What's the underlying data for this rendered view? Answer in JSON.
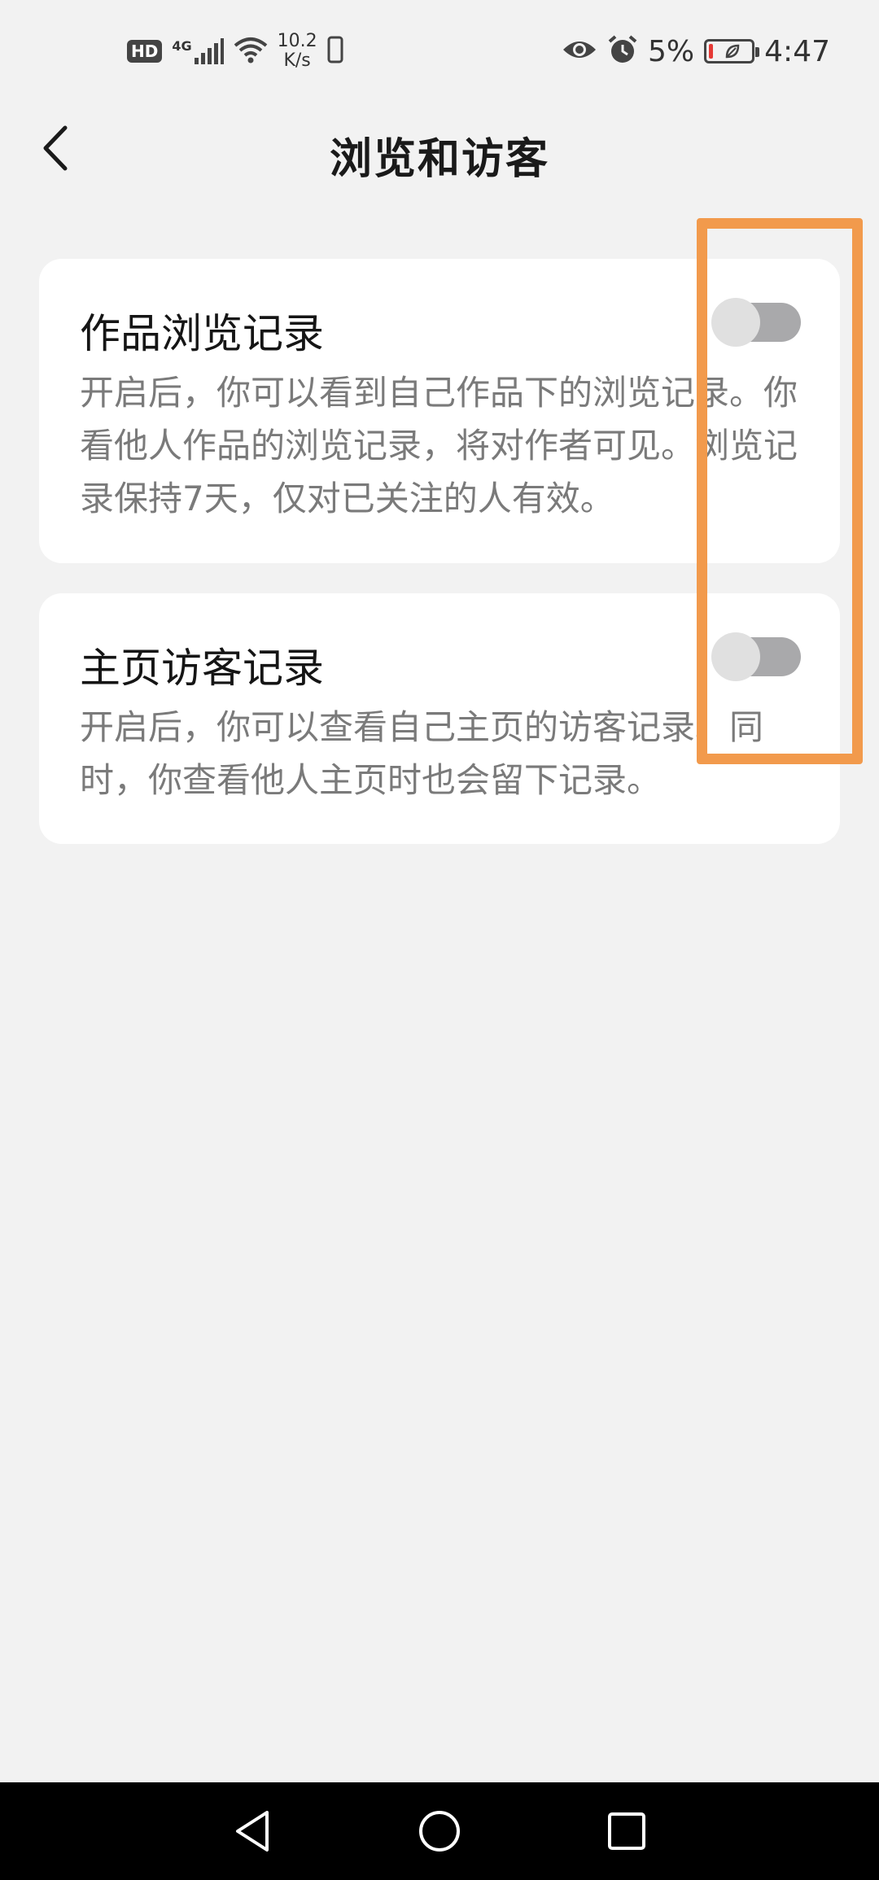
{
  "status_bar": {
    "hd": "HD",
    "network": "4G",
    "net_speed_value": "10.2",
    "net_speed_unit": "K/s",
    "battery_percent": "5%",
    "time": "4:47"
  },
  "header": {
    "title": "浏览和访客"
  },
  "settings": [
    {
      "title": "作品浏览记录",
      "description": "开启后，你可以看到自己作品下的浏览记录。你看他人作品的浏览记录，将对作者可见。浏览记录保持7天，仅对已关注的人有效。",
      "enabled": false
    },
    {
      "title": "主页访客记录",
      "description": "开启后，你可以查看自己主页的访客记录。同时，你查看他人主页时也会留下记录。",
      "enabled": false
    }
  ],
  "colors": {
    "background": "#f2f2f2",
    "card": "#ffffff",
    "toggle_off_track": "#a9a9ab",
    "highlight": "#f29a4c",
    "nav_bar": "#000000"
  },
  "icons": {
    "back": "chevron-left-icon",
    "nav_back": "triangle-back-icon",
    "nav_home": "circle-home-icon",
    "nav_recent": "square-recent-icon"
  }
}
